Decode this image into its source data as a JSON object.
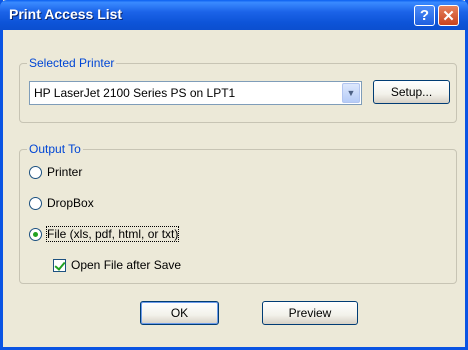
{
  "window": {
    "title": "Print Access List",
    "help_glyph": "?",
    "close_glyph": "✕"
  },
  "selected_printer": {
    "group_label": "Selected Printer",
    "printer_value": "HP LaserJet 2100 Series PS on LPT1",
    "setup_label": "Setup..."
  },
  "output_to": {
    "group_label": "Output To",
    "options": [
      {
        "label": "Printer",
        "selected": false
      },
      {
        "label": "DropBox",
        "selected": false
      },
      {
        "label": "File (xls, pdf, html, or txt)",
        "selected": true
      }
    ],
    "open_file_label": "Open File after Save",
    "open_file_checked": true
  },
  "buttons": {
    "ok_label": "OK",
    "preview_label": "Preview"
  },
  "colors": {
    "titlebar": "#0B4FCF",
    "group_label": "#0046D5",
    "radio_checked": "#21A121"
  }
}
